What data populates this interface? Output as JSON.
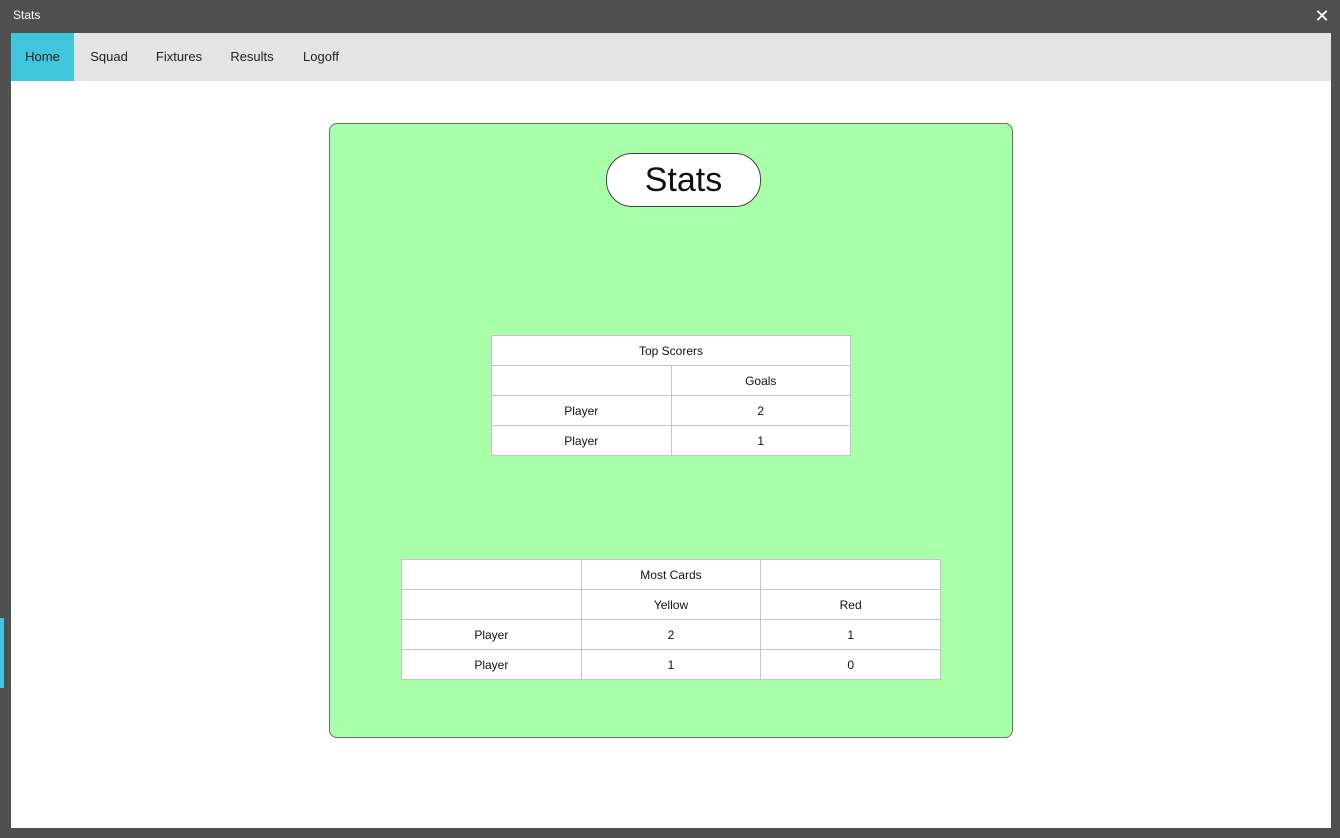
{
  "window": {
    "title": "Stats",
    "close_glyph": "✕"
  },
  "menu": {
    "items": [
      "Home",
      "Squad",
      "Fixtures",
      "Results",
      "Logoff"
    ],
    "active": "Home"
  },
  "panel": {
    "heading": "Stats"
  },
  "top_scorers": {
    "title": "Top Scorers",
    "header": [
      "",
      "Goals"
    ],
    "rows": [
      [
        "Player",
        "2"
      ],
      [
        "Player",
        "1"
      ]
    ]
  },
  "most_cards": {
    "title_row": [
      "",
      "Most Cards",
      ""
    ],
    "header": [
      "",
      "Yellow",
      "Red"
    ],
    "rows": [
      [
        "Player",
        "2",
        "1"
      ],
      [
        "Player",
        "1",
        "0"
      ]
    ]
  },
  "colors": {
    "accent": "#3fc6dd",
    "panel_bg": "#a9ffa9",
    "chrome": "#4f4f4f",
    "menubar": "#e4e4e4"
  },
  "icons": {
    "close": "close-icon"
  }
}
